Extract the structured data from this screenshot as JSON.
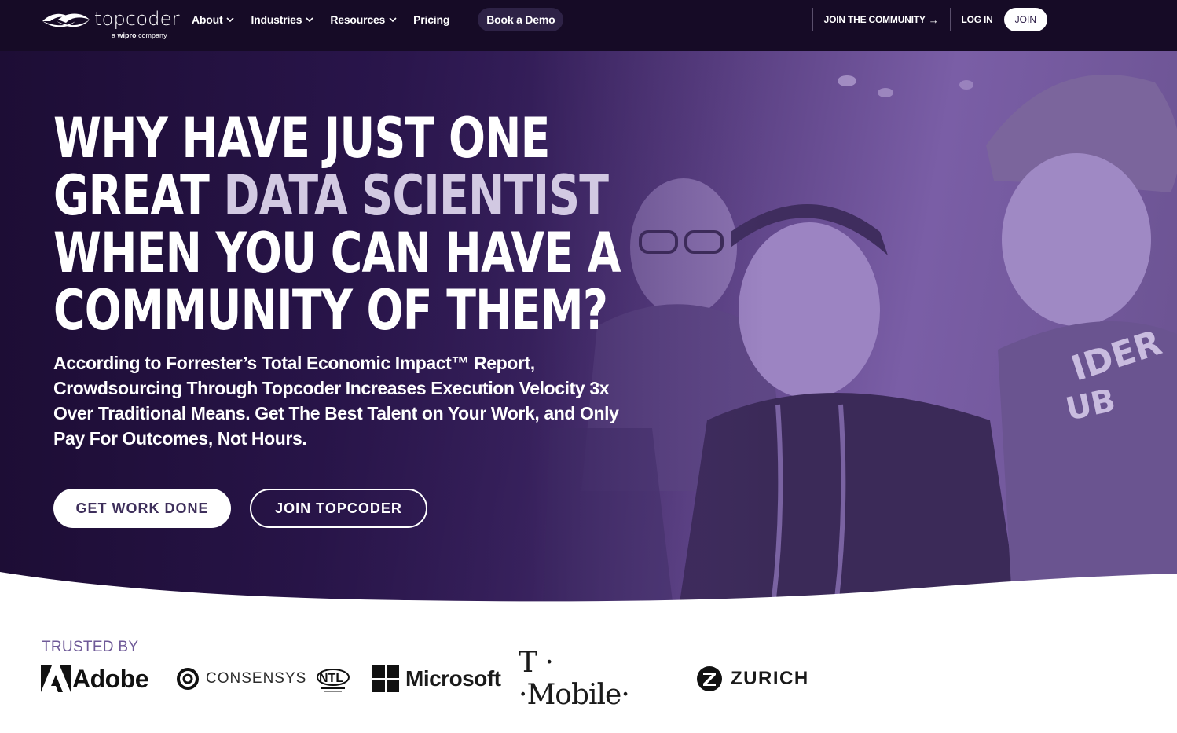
{
  "nav": {
    "logo_text": "topcoder",
    "logo_sub_prefix": "a",
    "logo_sub_brand": "wipro",
    "logo_sub_suffix": "company",
    "menu": [
      {
        "label": "About",
        "has_dropdown": true
      },
      {
        "label": "Industries",
        "has_dropdown": true
      },
      {
        "label": "Resources",
        "has_dropdown": true
      },
      {
        "label": "Pricing",
        "has_dropdown": false
      }
    ],
    "demo_label": "Book a Demo",
    "join_community_label": "JOIN THE COMMUNITY",
    "login_label": "LOG IN",
    "join_label": "JOIN"
  },
  "hero": {
    "headline_line1": "WHY HAVE JUST ONE",
    "headline_line2_a": "GREAT ",
    "headline_line2_accent": "DATA SCIENTIST",
    "headline_line3": "WHEN YOU CAN HAVE A",
    "headline_line4": "COMMUNITY OF THEM?",
    "subtext": "According to Forrester’s Total Economic Impact™ Report, Crowdsourcing Through Topcoder Increases Execution Velocity 3x Over Traditional Means. Get The Best Talent on Your Work, and Only Pay For Outcomes, Not Hours.",
    "primary_cta": "GET WORK DONE",
    "secondary_cta": "JOIN TOPCODER"
  },
  "trusted": {
    "label": "TRUSTED BY",
    "brands": {
      "adobe": "Adobe",
      "consensys": "CONSENSYS",
      "ntl": "NTL",
      "microsoft": "Microsoft",
      "tmobile": "T · ·Mobile·",
      "zurich": "ZURICH"
    }
  },
  "colors": {
    "nav_bg": "#160b26",
    "hero_dark": "#1d0d35",
    "hero_light": "#7a5ea6",
    "accent_text": "#d2c9e2",
    "trusted_label": "#6f5a98"
  }
}
